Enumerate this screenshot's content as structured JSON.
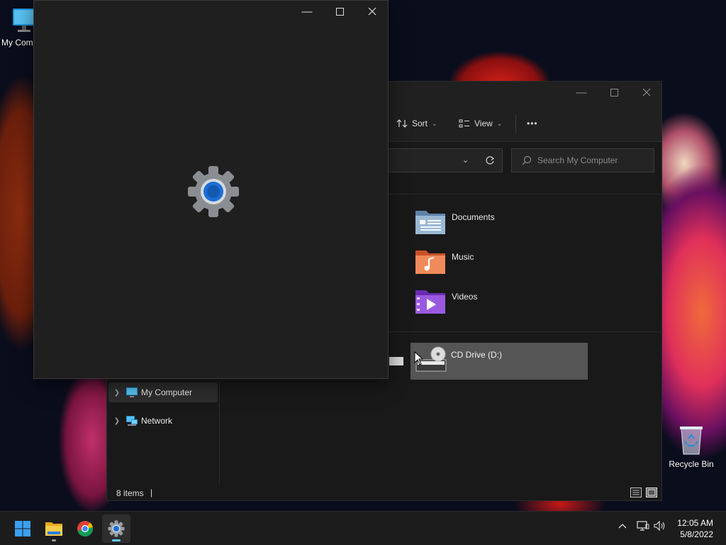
{
  "desktop": {
    "my_computer_label": "My Com",
    "recycle_bin_label": "Recycle Bin"
  },
  "explorer": {
    "toolbar": {
      "sort_label": "Sort",
      "view_label": "View",
      "more_label": "•••"
    },
    "search_placeholder": "Search My Computer",
    "folders": [
      {
        "label": "Documents",
        "icon": "documents-folder-icon"
      },
      {
        "label": "Music",
        "icon": "music-folder-icon"
      },
      {
        "label": "Videos",
        "icon": "videos-folder-icon"
      }
    ],
    "drive": {
      "label": "CD Drive (D:)",
      "icon": "cd-drive-icon"
    },
    "nav": [
      {
        "label": "My Computer",
        "icon": "computer-icon",
        "selected": true
      },
      {
        "label": "Network",
        "icon": "network-icon",
        "selected": false
      }
    ],
    "status": {
      "item_count": "8 items",
      "cursor": "|"
    }
  },
  "settings_window": {
    "icon": "gear-icon"
  },
  "taskbar": {
    "apps": [
      "start-icon",
      "file-explorer-icon",
      "chrome-icon",
      "settings-icon"
    ],
    "tray": {
      "chevron": "^"
    },
    "clock": {
      "time": "12:05 AM",
      "date": "5/8/2022"
    }
  },
  "colors": {
    "accent": "#1a6fd6",
    "selection": "#555555",
    "window_bg": "#1f1f1f"
  }
}
